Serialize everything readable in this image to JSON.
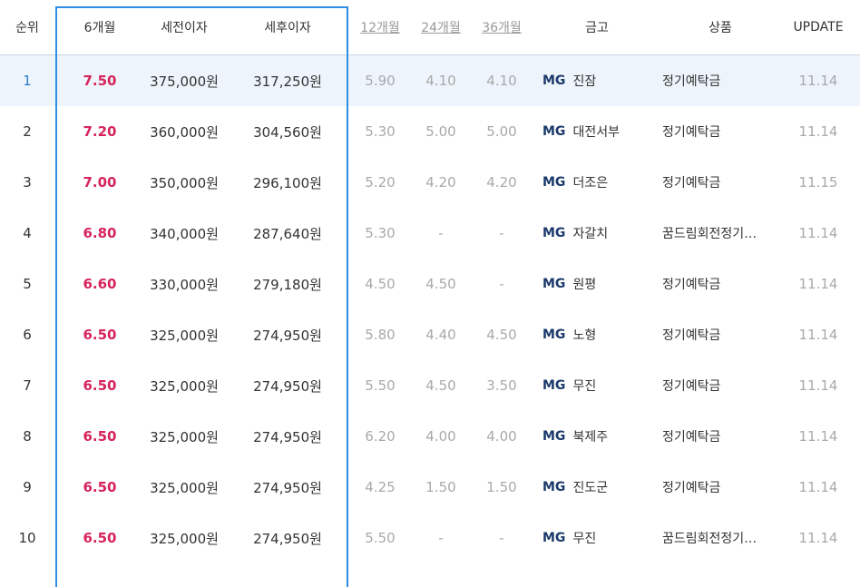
{
  "headers": {
    "rank": "순위",
    "m6": "6개월",
    "pretax": "세전이자",
    "posttax": "세후이자",
    "m12": "12개월",
    "m24": "24개월",
    "m36": "36개월",
    "bank": "금고",
    "product": "상품",
    "update": "UPDATE"
  },
  "bank_prefix": "MG",
  "rows": [
    {
      "rank": "1",
      "m6": "7.50",
      "pretax": "375,000원",
      "posttax": "317,250원",
      "m12": "5.90",
      "m24": "4.10",
      "m36": "4.10",
      "bank": "진잠",
      "product": "정기예탁금",
      "update": "11.14"
    },
    {
      "rank": "2",
      "m6": "7.20",
      "pretax": "360,000원",
      "posttax": "304,560원",
      "m12": "5.30",
      "m24": "5.00",
      "m36": "5.00",
      "bank": "대전서부",
      "product": "정기예탁금",
      "update": "11.14"
    },
    {
      "rank": "3",
      "m6": "7.00",
      "pretax": "350,000원",
      "posttax": "296,100원",
      "m12": "5.20",
      "m24": "4.20",
      "m36": "4.20",
      "bank": "더조은",
      "product": "정기예탁금",
      "update": "11.15"
    },
    {
      "rank": "4",
      "m6": "6.80",
      "pretax": "340,000원",
      "posttax": "287,640원",
      "m12": "5.30",
      "m24": "-",
      "m36": "-",
      "bank": "자갈치",
      "product": "꿈드림회전정기…",
      "update": "11.14"
    },
    {
      "rank": "5",
      "m6": "6.60",
      "pretax": "330,000원",
      "posttax": "279,180원",
      "m12": "4.50",
      "m24": "4.50",
      "m36": "-",
      "bank": "원평",
      "product": "정기예탁금",
      "update": "11.14"
    },
    {
      "rank": "6",
      "m6": "6.50",
      "pretax": "325,000원",
      "posttax": "274,950원",
      "m12": "5.80",
      "m24": "4.40",
      "m36": "4.50",
      "bank": "노형",
      "product": "정기예탁금",
      "update": "11.14"
    },
    {
      "rank": "7",
      "m6": "6.50",
      "pretax": "325,000원",
      "posttax": "274,950원",
      "m12": "5.50",
      "m24": "4.50",
      "m36": "3.50",
      "bank": "무진",
      "product": "정기예탁금",
      "update": "11.14"
    },
    {
      "rank": "8",
      "m6": "6.50",
      "pretax": "325,000원",
      "posttax": "274,950원",
      "m12": "6.20",
      "m24": "4.00",
      "m36": "4.00",
      "bank": "북제주",
      "product": "정기예탁금",
      "update": "11.14"
    },
    {
      "rank": "9",
      "m6": "6.50",
      "pretax": "325,000원",
      "posttax": "274,950원",
      "m12": "4.25",
      "m24": "1.50",
      "m36": "1.50",
      "bank": "진도군",
      "product": "정기예탁금",
      "update": "11.14"
    },
    {
      "rank": "10",
      "m6": "6.50",
      "pretax": "325,000원",
      "posttax": "274,950원",
      "m12": "5.50",
      "m24": "-",
      "m36": "-",
      "bank": "무진",
      "product": "꿈드림회전정기…",
      "update": "11.14"
    }
  ],
  "colors": {
    "accent_rate": "#d6245b",
    "highlight_border": "#2f8fe3",
    "first_row_bg": "#eef4fb",
    "bank_prefix": "#1b3a6b",
    "muted": "#a9a9a9"
  }
}
